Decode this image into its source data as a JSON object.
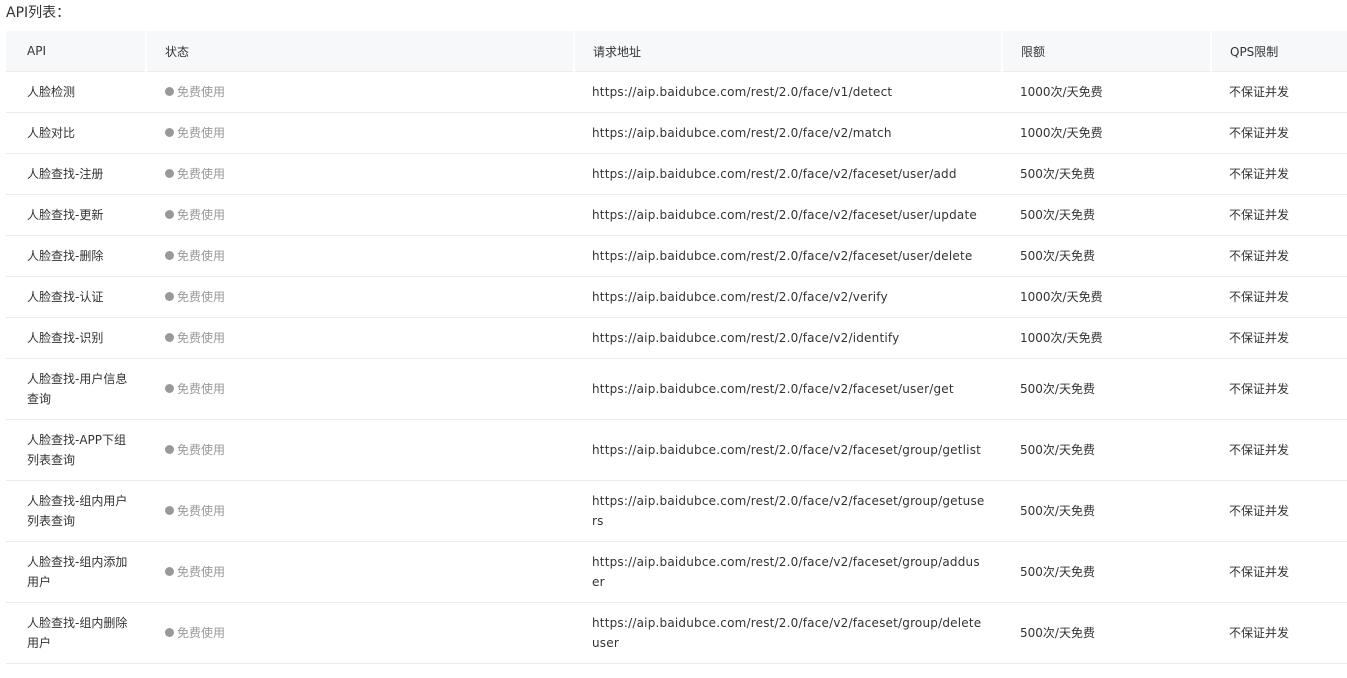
{
  "page": {
    "title": "API列表："
  },
  "table": {
    "headers": {
      "api": "API",
      "status": "状态",
      "url": "请求地址",
      "quota": "限额",
      "qps": "QPS限制"
    },
    "rows": [
      {
        "api": "人脸检测",
        "status": "免费使用",
        "url": "https://aip.baidubce.com/rest/2.0/face/v1/detect",
        "quota": "1000次/天免费",
        "qps": "不保证并发"
      },
      {
        "api": "人脸对比",
        "status": "免费使用",
        "url": "https://aip.baidubce.com/rest/2.0/face/v2/match",
        "quota": "1000次/天免费",
        "qps": "不保证并发"
      },
      {
        "api": "人脸查找-注册",
        "status": "免费使用",
        "url": "https://aip.baidubce.com/rest/2.0/face/v2/faceset/user/add",
        "quota": "500次/天免费",
        "qps": "不保证并发"
      },
      {
        "api": "人脸查找-更新",
        "status": "免费使用",
        "url": "https://aip.baidubce.com/rest/2.0/face/v2/faceset/user/update",
        "quota": "500次/天免费",
        "qps": "不保证并发"
      },
      {
        "api": "人脸查找-删除",
        "status": "免费使用",
        "url": "https://aip.baidubce.com/rest/2.0/face/v2/faceset/user/delete",
        "quota": "500次/天免费",
        "qps": "不保证并发"
      },
      {
        "api": "人脸查找-认证",
        "status": "免费使用",
        "url": "https://aip.baidubce.com/rest/2.0/face/v2/verify",
        "quota": "1000次/天免费",
        "qps": "不保证并发"
      },
      {
        "api": "人脸查找-识别",
        "status": "免费使用",
        "url": "https://aip.baidubce.com/rest/2.0/face/v2/identify",
        "quota": "1000次/天免费",
        "qps": "不保证并发"
      },
      {
        "api": "人脸查找-用户信息查询",
        "status": "免费使用",
        "url": "https://aip.baidubce.com/rest/2.0/face/v2/faceset/user/get",
        "quota": "500次/天免费",
        "qps": "不保证并发"
      },
      {
        "api": "人脸查找-APP下组列表查询",
        "status": "免费使用",
        "url": "https://aip.baidubce.com/rest/2.0/face/v2/faceset/group/getlist",
        "quota": "500次/天免费",
        "qps": "不保证并发"
      },
      {
        "api": "人脸查找-组内用户列表查询",
        "status": "免费使用",
        "url": "https://aip.baidubce.com/rest/2.0/face/v2/faceset/group/getusers",
        "quota": "500次/天免费",
        "qps": "不保证并发"
      },
      {
        "api": "人脸查找-组内添加用户",
        "status": "免费使用",
        "url": "https://aip.baidubce.com/rest/2.0/face/v2/faceset/group/adduser",
        "quota": "500次/天免费",
        "qps": "不保证并发"
      },
      {
        "api": "人脸查找-组内删除用户",
        "status": "免费使用",
        "url": "https://aip.baidubce.com/rest/2.0/face/v2/faceset/group/deleteuser",
        "quota": "500次/天免费",
        "qps": "不保证并发"
      }
    ]
  },
  "colors": {
    "header_bg": "#f7f8fa",
    "status_gray": "#999999",
    "border": "#ebebeb",
    "text": "#333333"
  },
  "icons": {
    "status": "status-dot-icon"
  }
}
